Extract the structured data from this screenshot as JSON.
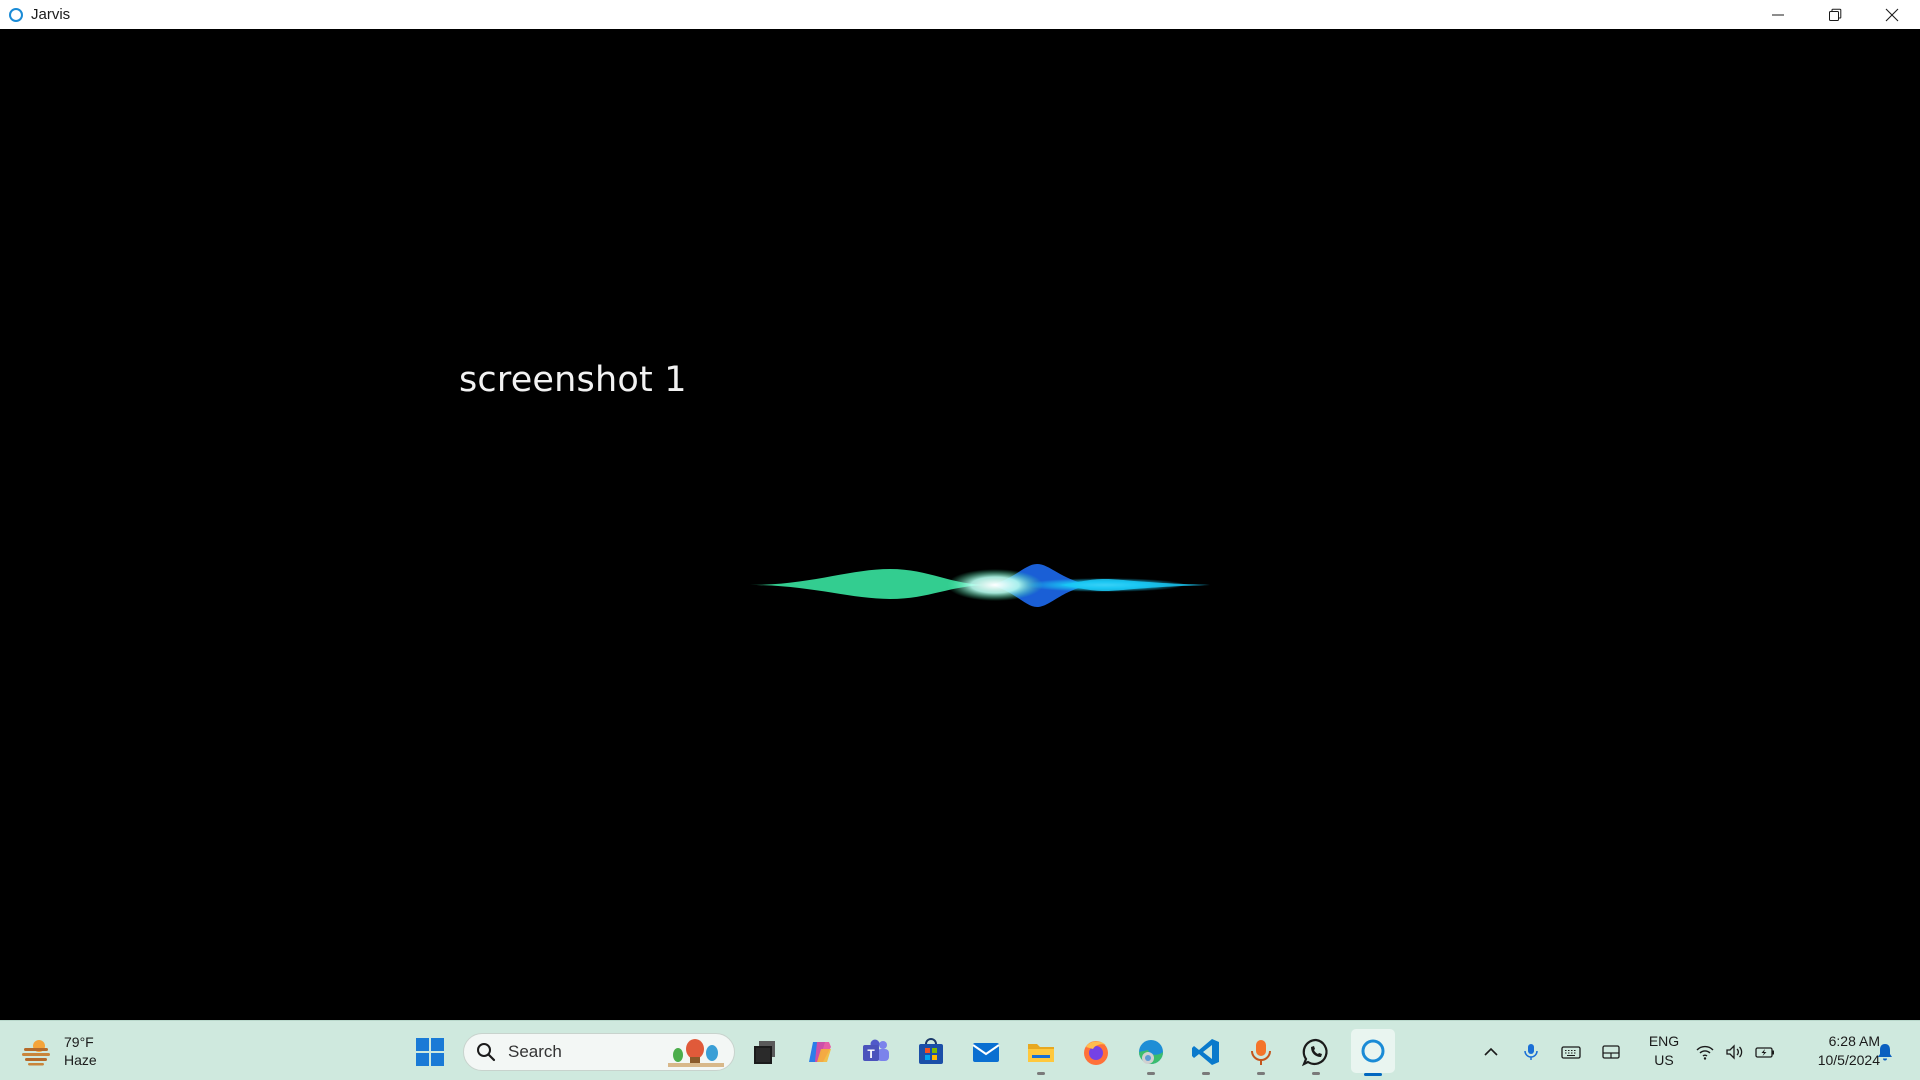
{
  "window": {
    "title": "Jarvis",
    "controls": [
      "minimize",
      "restore",
      "close"
    ]
  },
  "main": {
    "transcript": "screenshot 1",
    "waveform_colors": [
      "#39e3a0",
      "#1a5fd6",
      "#1ac8f5"
    ]
  },
  "taskbar": {
    "weather": {
      "temp": "79°F",
      "condition": "Haze",
      "icon": "haze-icon"
    },
    "search": {
      "label": "Search"
    },
    "pinned_apps": [
      {
        "name": "start",
        "icon": "windows-logo-icon"
      },
      {
        "name": "task-view",
        "icon": "task-view-icon"
      },
      {
        "name": "copilot",
        "icon": "copilot-icon"
      },
      {
        "name": "teams",
        "icon": "teams-icon"
      },
      {
        "name": "microsoft-store",
        "icon": "store-icon"
      },
      {
        "name": "mail",
        "icon": "mail-icon"
      },
      {
        "name": "file-explorer",
        "icon": "folder-icon"
      },
      {
        "name": "firefox",
        "icon": "firefox-icon"
      },
      {
        "name": "edge-dev",
        "icon": "edge-icon"
      },
      {
        "name": "vscode",
        "icon": "vscode-icon"
      },
      {
        "name": "microphone-app",
        "icon": "microphone-icon"
      },
      {
        "name": "whatsapp",
        "icon": "whatsapp-icon"
      },
      {
        "name": "jarvis",
        "icon": "jarvis-ring-icon"
      }
    ],
    "tray": {
      "language_line1": "ENG",
      "language_line2": "US",
      "time": "6:28 AM",
      "date": "10/5/2024"
    }
  }
}
